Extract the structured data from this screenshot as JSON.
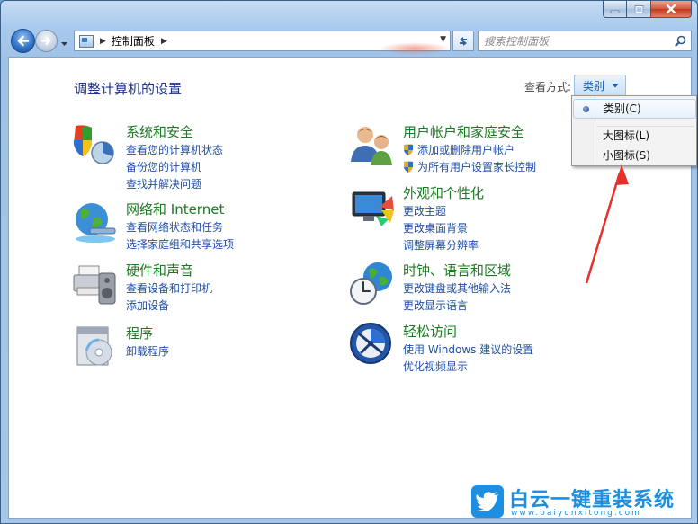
{
  "window": {
    "title": "控制面板",
    "address_crumb": "控制面板",
    "search_placeholder": "搜索控制面板"
  },
  "header": {
    "page_title": "调整计算机的设置",
    "view_by_label": "查看方式:",
    "view_by_value": "类别"
  },
  "view_menu": {
    "items": [
      {
        "label": "类别(C)",
        "selected": true
      },
      {
        "label": "大图标(L)",
        "selected": false
      },
      {
        "label": "小图标(S)",
        "selected": false
      }
    ]
  },
  "categories": [
    {
      "title": "系统和安全",
      "icon": "system-security-icon",
      "links": [
        "查看您的计算机状态",
        "备份您的计算机",
        "查找并解决问题"
      ]
    },
    {
      "title": "网络和 Internet",
      "icon": "network-icon",
      "links": [
        "查看网络状态和任务",
        "选择家庭组和共享选项"
      ]
    },
    {
      "title": "硬件和声音",
      "icon": "hardware-sound-icon",
      "links": [
        "查看设备和打印机",
        "添加设备"
      ]
    },
    {
      "title": "程序",
      "icon": "programs-icon",
      "links": [
        "卸载程序"
      ]
    },
    {
      "title": "用户帐户和家庭安全",
      "icon": "user-accounts-icon",
      "links": [
        "添加或删除用户帐户",
        "为所有用户设置家长控制"
      ]
    },
    {
      "title": "外观和个性化",
      "icon": "appearance-icon",
      "links": [
        "更改主题",
        "更改桌面背景",
        "调整屏幕分辨率"
      ]
    },
    {
      "title": "时钟、语言和区域",
      "icon": "clock-language-icon",
      "links": [
        "更改键盘或其他输入法",
        "更改显示语言"
      ]
    },
    {
      "title": "轻松访问",
      "icon": "ease-of-access-icon",
      "links": [
        "使用 Windows 建议的设置",
        "优化视频显示"
      ]
    }
  ],
  "watermark": {
    "brand": "白云一键重装系统",
    "url": "www.baiyunxitong.com"
  },
  "colors": {
    "link": "#1f4fa5",
    "category_title": "#1a7a20",
    "page_title": "#1e3287",
    "annotation_arrow": "#e8302a",
    "watermark": "#1d8fe0"
  }
}
